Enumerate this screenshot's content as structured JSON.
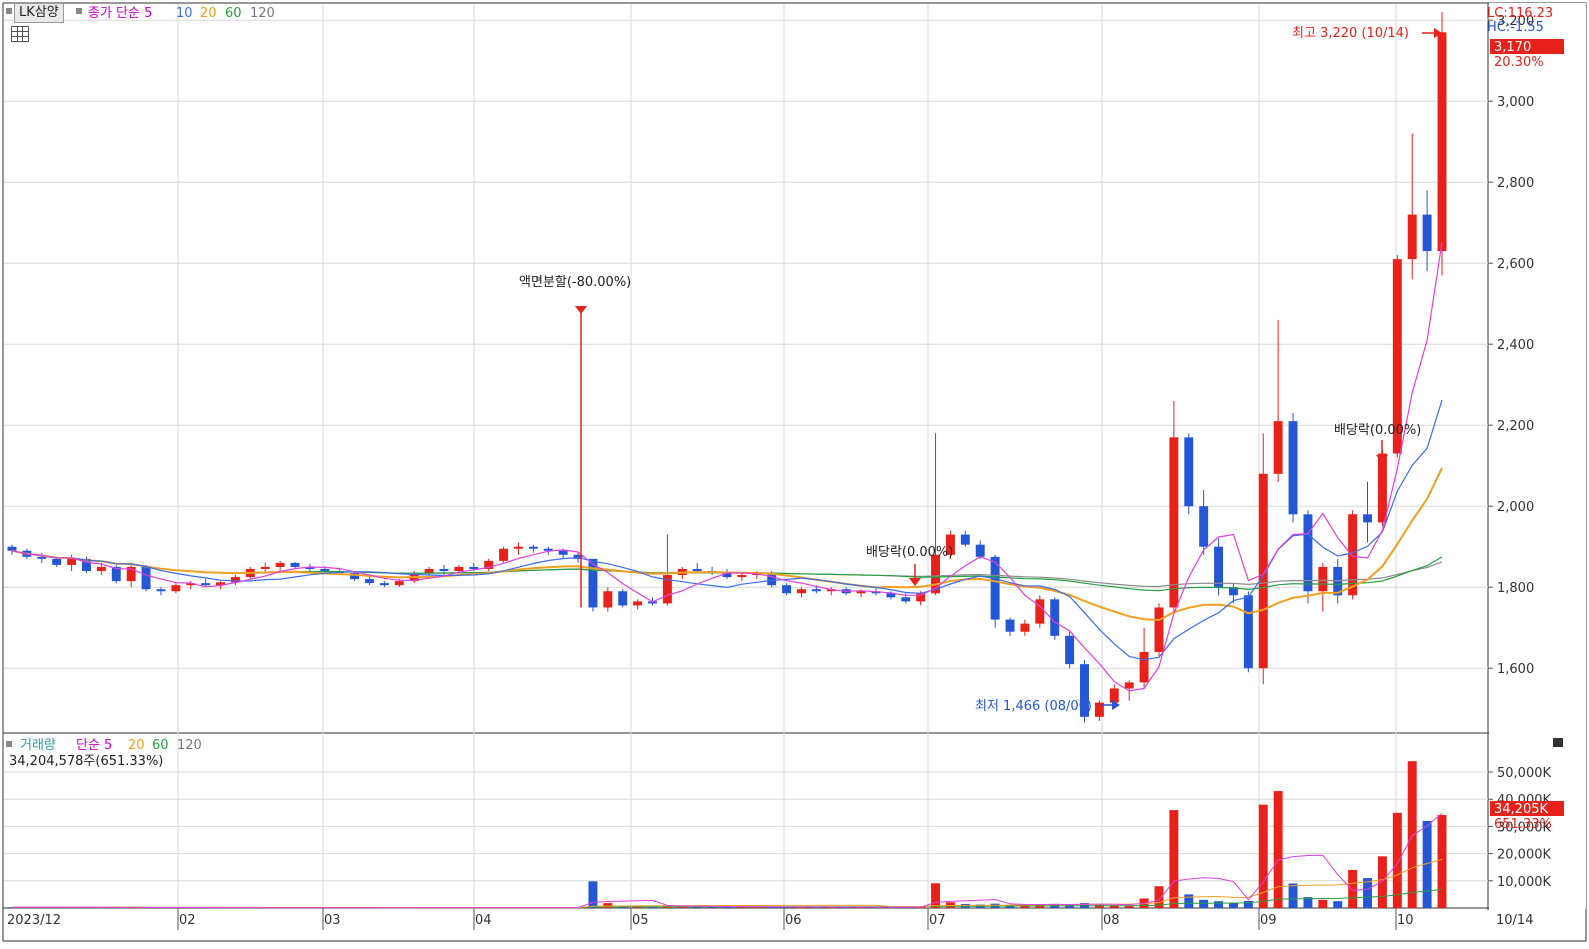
{
  "title": "LK삼양",
  "price_legend": {
    "label": "종가 단순",
    "ma": [
      "5",
      "10",
      "20",
      "60",
      "120"
    ]
  },
  "volume_legend": {
    "label": "거래량",
    "sub": "단순",
    "ma": [
      "5",
      "20",
      "60",
      "120"
    ],
    "current": "34,204,578주(651.33%)"
  },
  "corner": {
    "lc": "LC:116.23",
    "hc": "HC:-1.55"
  },
  "last_price": {
    "value": "3,170",
    "pct": "20.30%"
  },
  "last_volume": {
    "value": "34,205K",
    "pct": "651.33%"
  },
  "colors": {
    "up": "#e8211b",
    "down": "#2456d6",
    "ma5": "#e040e0",
    "ma10": "#3a6cf0",
    "ma20": "#f0a020",
    "ma60": "#26a040",
    "ma120": "#8a8a8a",
    "ma_label5": "#cc00cc",
    "ma_label10": "#3a6cf0",
    "ma_label20": "#f0a020",
    "ma_label60": "#26a040",
    "ma_label120": "#777777"
  },
  "chart_data": {
    "type": "candlestick",
    "x_labels": [
      "2023/12",
      "02",
      "03",
      "04",
      "05",
      "06",
      "07",
      "08",
      "09",
      "10",
      "10/14"
    ],
    "y_ticks": [
      "1,600",
      "1,800",
      "2,000",
      "2,200",
      "2,400",
      "2,600",
      "2,800",
      "3,000",
      "3,200"
    ],
    "ylim": [
      1440,
      3240
    ],
    "volume_ticks": [
      "10,000K",
      "20,000K",
      "30,000K",
      "40,000K",
      "50,000K"
    ],
    "volume_ylim_k": [
      0,
      57000
    ],
    "annotations": [
      {
        "text": "액면분할(-80.00%)",
        "date": "2024-04",
        "price": 2480
      },
      {
        "text": "배당락(0.00%)",
        "date": "2024-06",
        "price": 1830
      },
      {
        "text": "배당락(0.00%)",
        "date": "2024-09",
        "price": 2120
      },
      {
        "text": "최고 3,220 (10/14)",
        "date": "10/14",
        "price": 3220
      },
      {
        "text": "최저 1,466 (08/06)",
        "date": "08/06",
        "price": 1466
      }
    ],
    "candles_note": "weekly OHLC approximations read from chart",
    "candles": [
      [
        1900,
        1905,
        1880,
        1890
      ],
      [
        1890,
        1895,
        1870,
        1875
      ],
      [
        1875,
        1885,
        1860,
        1870
      ],
      [
        1870,
        1875,
        1850,
        1855
      ],
      [
        1855,
        1880,
        1840,
        1870
      ],
      [
        1870,
        1875,
        1835,
        1840
      ],
      [
        1840,
        1860,
        1830,
        1850
      ],
      [
        1850,
        1855,
        1810,
        1815
      ],
      [
        1815,
        1860,
        1800,
        1850
      ],
      [
        1850,
        1855,
        1790,
        1795
      ],
      [
        1795,
        1800,
        1780,
        1790
      ],
      [
        1790,
        1810,
        1785,
        1805
      ],
      [
        1805,
        1815,
        1795,
        1810
      ],
      [
        1810,
        1820,
        1800,
        1805
      ],
      [
        1805,
        1815,
        1795,
        1812
      ],
      [
        1812,
        1830,
        1805,
        1825
      ],
      [
        1825,
        1850,
        1820,
        1845
      ],
      [
        1845,
        1860,
        1835,
        1850
      ],
      [
        1850,
        1865,
        1840,
        1860
      ],
      [
        1860,
        1862,
        1845,
        1850
      ],
      [
        1850,
        1858,
        1840,
        1845
      ],
      [
        1845,
        1852,
        1835,
        1840
      ],
      [
        1840,
        1848,
        1830,
        1835
      ],
      [
        1835,
        1840,
        1815,
        1820
      ],
      [
        1820,
        1825,
        1805,
        1810
      ],
      [
        1810,
        1815,
        1800,
        1805
      ],
      [
        1805,
        1820,
        1800,
        1815
      ],
      [
        1815,
        1840,
        1810,
        1835
      ],
      [
        1835,
        1850,
        1825,
        1845
      ],
      [
        1845,
        1855,
        1830,
        1840
      ],
      [
        1840,
        1855,
        1835,
        1850
      ],
      [
        1850,
        1860,
        1840,
        1845
      ],
      [
        1845,
        1870,
        1840,
        1865
      ],
      [
        1865,
        1900,
        1860,
        1895
      ],
      [
        1895,
        1910,
        1880,
        1900
      ],
      [
        1900,
        1905,
        1885,
        1895
      ],
      [
        1895,
        1900,
        1880,
        1890
      ],
      [
        1890,
        1895,
        1870,
        1880
      ],
      [
        1880,
        1885,
        1860,
        1870
      ],
      [
        1870,
        1870,
        1740,
        1750
      ],
      [
        1750,
        1800,
        1740,
        1790
      ],
      [
        1790,
        1795,
        1750,
        1755
      ],
      [
        1755,
        1770,
        1745,
        1765
      ],
      [
        1765,
        1775,
        1755,
        1760
      ],
      [
        1760,
        1930,
        1755,
        1830
      ],
      [
        1830,
        1850,
        1820,
        1845
      ],
      [
        1845,
        1860,
        1835,
        1840
      ],
      [
        1840,
        1850,
        1830,
        1835
      ],
      [
        1835,
        1845,
        1820,
        1825
      ],
      [
        1825,
        1835,
        1815,
        1830
      ],
      [
        1830,
        1840,
        1820,
        1835
      ],
      [
        1835,
        1840,
        1800,
        1805
      ],
      [
        1805,
        1810,
        1780,
        1785
      ],
      [
        1785,
        1800,
        1775,
        1795
      ],
      [
        1795,
        1805,
        1785,
        1790
      ],
      [
        1790,
        1800,
        1780,
        1795
      ],
      [
        1795,
        1800,
        1780,
        1785
      ],
      [
        1785,
        1795,
        1775,
        1790
      ],
      [
        1790,
        1800,
        1780,
        1785
      ],
      [
        1785,
        1790,
        1770,
        1775
      ],
      [
        1775,
        1785,
        1760,
        1765
      ],
      [
        1765,
        1790,
        1755,
        1785
      ],
      [
        1785,
        2180,
        1780,
        1880
      ],
      [
        1880,
        1940,
        1870,
        1930
      ],
      [
        1930,
        1940,
        1900,
        1905
      ],
      [
        1905,
        1915,
        1870,
        1875
      ],
      [
        1875,
        1880,
        1700,
        1720
      ],
      [
        1720,
        1725,
        1680,
        1690
      ],
      [
        1690,
        1720,
        1680,
        1710
      ],
      [
        1710,
        1780,
        1700,
        1770
      ],
      [
        1770,
        1775,
        1670,
        1680
      ],
      [
        1680,
        1690,
        1600,
        1610
      ],
      [
        1610,
        1620,
        1466,
        1480
      ],
      [
        1480,
        1520,
        1470,
        1515
      ],
      [
        1515,
        1560,
        1500,
        1550
      ],
      [
        1550,
        1570,
        1520,
        1565
      ],
      [
        1565,
        1700,
        1550,
        1640
      ],
      [
        1640,
        1760,
        1630,
        1750
      ],
      [
        1750,
        2260,
        1740,
        2170
      ],
      [
        2170,
        2180,
        1980,
        2000
      ],
      [
        2000,
        2040,
        1880,
        1900
      ],
      [
        1900,
        1920,
        1780,
        1800
      ],
      [
        1800,
        1810,
        1760,
        1780
      ],
      [
        1780,
        1790,
        1590,
        1600
      ],
      [
        1600,
        2180,
        1560,
        2080
      ],
      [
        2080,
        2460,
        2060,
        2210
      ],
      [
        2210,
        2230,
        1960,
        1980
      ],
      [
        1980,
        1990,
        1760,
        1790
      ],
      [
        1790,
        1860,
        1740,
        1850
      ],
      [
        1850,
        1870,
        1760,
        1780
      ],
      [
        1780,
        1990,
        1770,
        1980
      ],
      [
        1980,
        2060,
        1910,
        1960
      ],
      [
        1960,
        2140,
        1950,
        2130
      ],
      [
        2130,
        2620,
        2120,
        2610
      ],
      [
        2610,
        2920,
        2560,
        2720
      ],
      [
        2720,
        2780,
        2580,
        2630
      ],
      [
        2630,
        3220,
        2570,
        3170
      ]
    ],
    "volumes_k": [
      300,
      280,
      260,
      250,
      240,
      230,
      220,
      210,
      200,
      190,
      180,
      170,
      160,
      150,
      150,
      140,
      150,
      160,
      170,
      160,
      150,
      140,
      140,
      130,
      120,
      120,
      130,
      150,
      160,
      150,
      150,
      140,
      150,
      170,
      180,
      160,
      150,
      140,
      130,
      9800,
      1800,
      900,
      800,
      600,
      700,
      600,
      500,
      500,
      450,
      400,
      420,
      380,
      360,
      350,
      330,
      320,
      300,
      290,
      280,
      270,
      260,
      380,
      9100,
      2100,
      1500,
      1300,
      1600,
      1200,
      1000,
      1300,
      1500,
      1400,
      1800,
      1200,
      1000,
      900,
      3500,
      8000,
      36000,
      5000,
      3000,
      2500,
      2000,
      2600,
      38000,
      43000,
      9000,
      4000,
      3000,
      2500,
      14000,
      11000,
      19000,
      35000,
      54000,
      32000,
      34205
    ]
  }
}
